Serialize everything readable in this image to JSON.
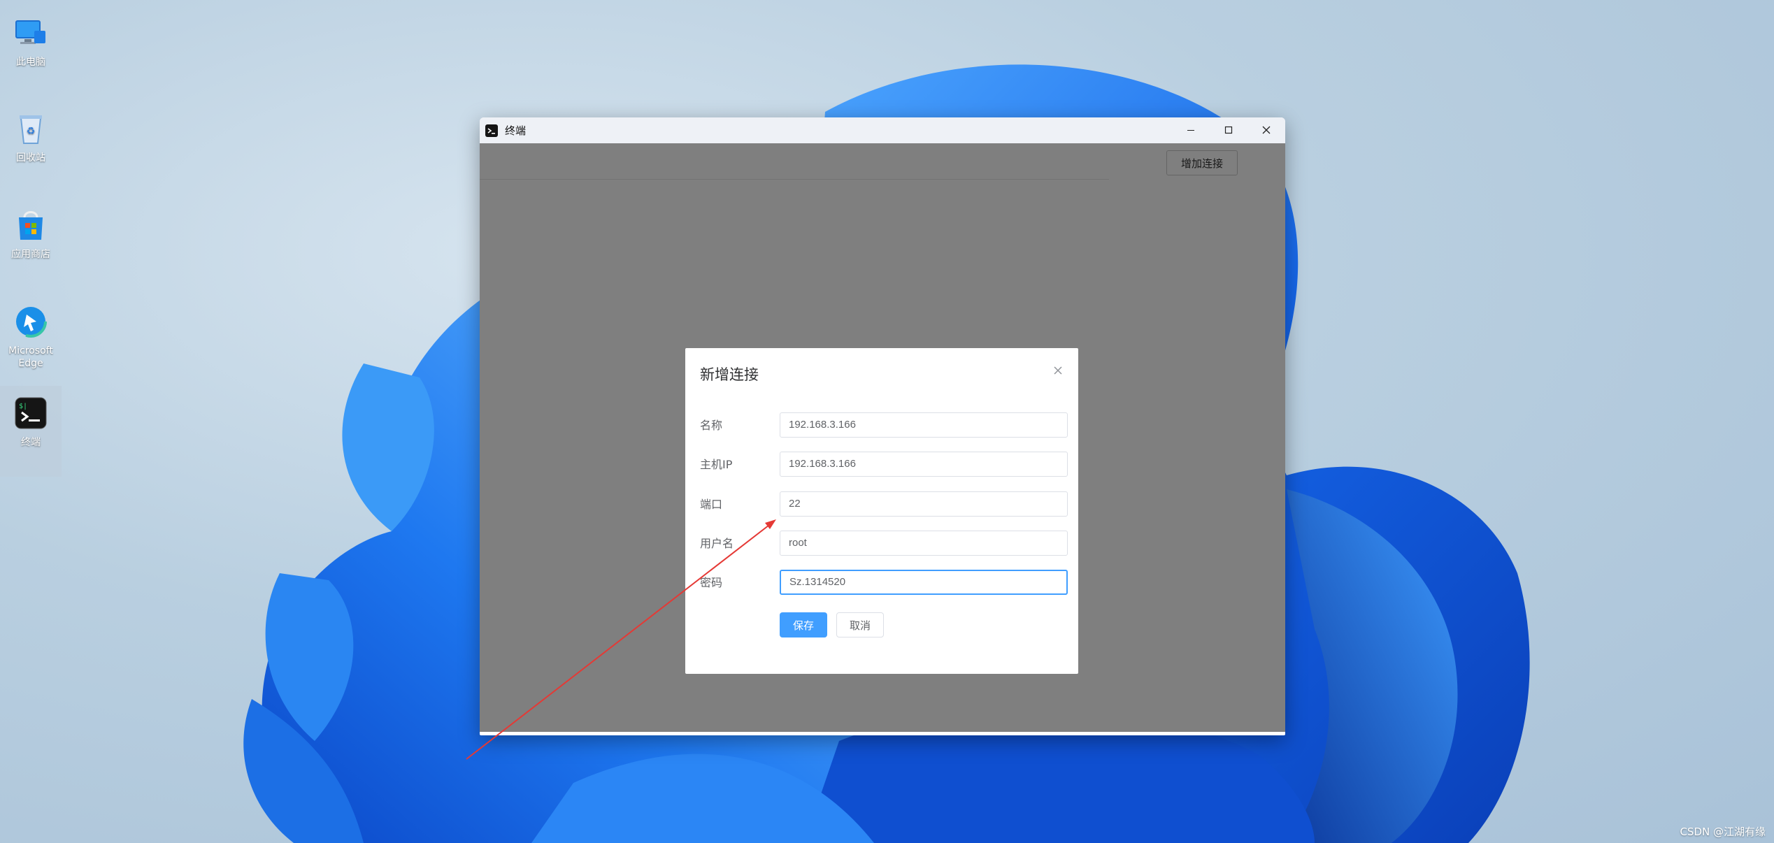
{
  "desktop": {
    "icons": [
      {
        "label": "此电脑",
        "icon": "computer-icon"
      },
      {
        "label": "回收站",
        "icon": "recycle-bin-icon"
      },
      {
        "label": "应用商店",
        "icon": "store-icon"
      },
      {
        "label": "Microsoft Edge",
        "icon": "edge-icon"
      },
      {
        "label": "终端",
        "icon": "terminal-icon"
      }
    ]
  },
  "window": {
    "title": "终端",
    "add_connection_label": "增加连接",
    "controls": [
      "minimize-icon",
      "maximize-icon",
      "close-icon"
    ]
  },
  "dialog": {
    "title": "新增连接",
    "fields": [
      {
        "label": "名称",
        "value": "192.168.3.166"
      },
      {
        "label": "主机IP",
        "value": "192.168.3.166"
      },
      {
        "label": "端口",
        "value": "22"
      },
      {
        "label": "用户名",
        "value": "root"
      },
      {
        "label": "密码",
        "value": "Sz.1314520"
      }
    ],
    "save_label": "保存",
    "cancel_label": "取消"
  },
  "watermark": "CSDN @江湖有缘",
  "colors": {
    "primary": "#409eff",
    "annotation": "#e53935",
    "overlay": "rgba(0,0,0,0.5)"
  }
}
